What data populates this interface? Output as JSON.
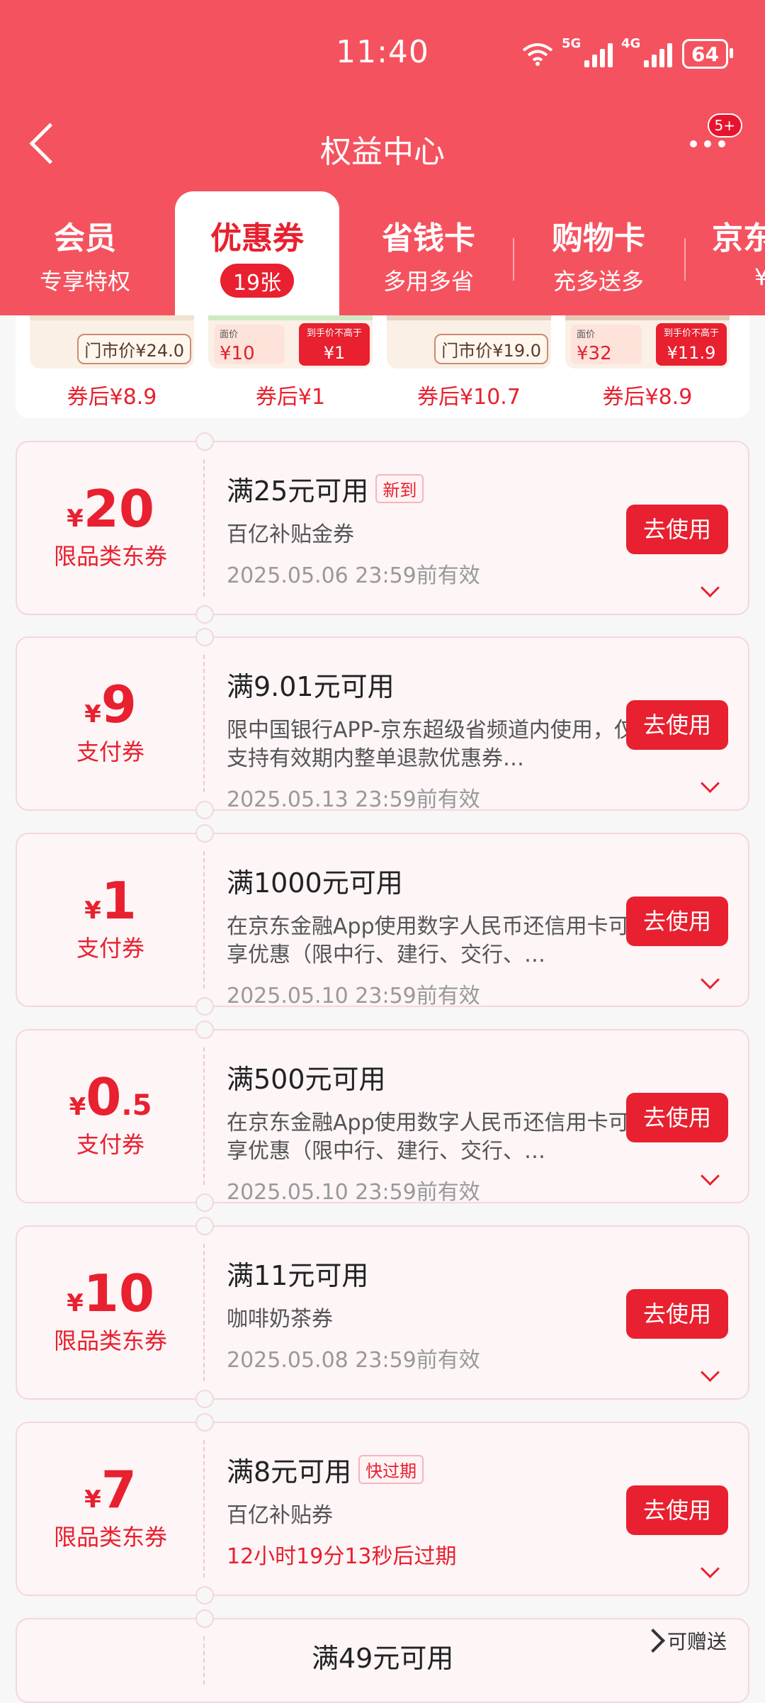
{
  "status": {
    "time": "11:40",
    "net1": "5G",
    "net2": "4G",
    "battery": "64"
  },
  "nav": {
    "title": "权益中心",
    "badge": "5+"
  },
  "tabs": [
    {
      "label": "会员",
      "sub": "专享特权"
    },
    {
      "label": "优惠券",
      "count": "19张"
    },
    {
      "label": "省钱卡",
      "sub": "多用多省"
    },
    {
      "label": "购物卡",
      "sub": "充多送多"
    },
    {
      "label": "京东",
      "sub": "¥"
    }
  ],
  "products": [
    {
      "price_label": "门市价¥24.0",
      "after": "券后¥8.9"
    },
    {
      "badge1": "面价",
      "value1": "¥10",
      "badge2": "到手价不高于",
      "value2": "¥1",
      "after": "券后¥1"
    },
    {
      "price_label": "门市价¥19.0",
      "after": "券后¥10.7"
    },
    {
      "badge1": "面价",
      "value1": "¥32",
      "badge2": "到手价不高于",
      "value2": "¥11.9",
      "after": "券后¥8.9"
    }
  ],
  "coupons": [
    {
      "yen": "¥",
      "num": "20",
      "dec": "",
      "type": "限品类东券",
      "cond": "满25元可用",
      "tag": "新到",
      "desc": "百亿补贴金券",
      "exp": "2025.05.06 23:59前有效",
      "exp_red": false,
      "btn": "去使用"
    },
    {
      "yen": "¥",
      "num": "9",
      "dec": "",
      "type": "支付券",
      "cond": "满9.01元可用",
      "tag": "",
      "desc": "限中国银行APP-京东超级省频道内使用，仅支持有效期内整单退款优惠券…",
      "exp": "2025.05.13 23:59前有效",
      "exp_red": false,
      "btn": "去使用"
    },
    {
      "yen": "¥",
      "num": "1",
      "dec": "",
      "type": "支付券",
      "cond": "满1000元可用",
      "tag": "",
      "desc": "在京东金融App使用数字人民币还信用卡可享优惠（限中行、建行、交行、…",
      "exp": "2025.05.10 23:59前有效",
      "exp_red": false,
      "btn": "去使用"
    },
    {
      "yen": "¥",
      "num": "0",
      "dec": ".5",
      "type": "支付券",
      "cond": "满500元可用",
      "tag": "",
      "desc": "在京东金融App使用数字人民币还信用卡可享优惠（限中行、建行、交行、…",
      "exp": "2025.05.10 23:59前有效",
      "exp_red": false,
      "btn": "去使用"
    },
    {
      "yen": "¥",
      "num": "10",
      "dec": "",
      "type": "限品类东券",
      "cond": "满11元可用",
      "tag": "",
      "desc": "咖啡奶茶券",
      "exp": "2025.05.08 23:59前有效",
      "exp_red": false,
      "btn": "去使用"
    },
    {
      "yen": "¥",
      "num": "7",
      "dec": "",
      "type": "限品类东券",
      "cond": "满8元可用",
      "tag": "快过期",
      "desc": "百亿补贴券",
      "exp": "12小时19分13秒后过期",
      "exp_red": true,
      "btn": "去使用"
    },
    {
      "cond": "满49元可用",
      "gift": "可赠送"
    }
  ]
}
